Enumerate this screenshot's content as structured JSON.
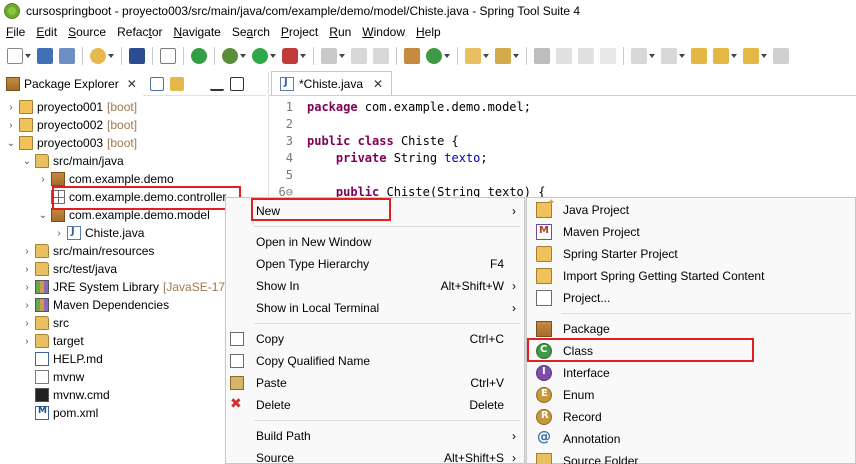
{
  "window": {
    "title": "cursospringboot - proyecto003/src/main/java/com/example/demo/model/Chiste.java - Spring Tool Suite 4"
  },
  "menu": [
    {
      "pre": "",
      "u": "F",
      "post": "ile"
    },
    {
      "pre": "",
      "u": "E",
      "post": "dit"
    },
    {
      "pre": "",
      "u": "S",
      "post": "ource"
    },
    {
      "pre": "Refac",
      "u": "t",
      "post": "or"
    },
    {
      "pre": "",
      "u": "N",
      "post": "avigate"
    },
    {
      "pre": "Se",
      "u": "a",
      "post": "rch"
    },
    {
      "pre": "",
      "u": "P",
      "post": "roject"
    },
    {
      "pre": "",
      "u": "R",
      "post": "un"
    },
    {
      "pre": "",
      "u": "W",
      "post": "indow"
    },
    {
      "pre": "",
      "u": "H",
      "post": "elp"
    }
  ],
  "explorer": {
    "tab_label": "Package Explorer",
    "close": "✕",
    "tree": [
      {
        "twisty": "›",
        "icon": "project",
        "label": "proyecto001",
        "suffix": "[boot]"
      },
      {
        "twisty": "›",
        "icon": "project",
        "label": "proyecto002",
        "suffix": "[boot]"
      },
      {
        "twisty": "⌄",
        "icon": "project",
        "label": "proyecto003",
        "suffix": "[boot]"
      },
      {
        "twisty": "⌄",
        "icon": "folder",
        "label": "src/main/java",
        "suffix": ""
      },
      {
        "twisty": "›",
        "icon": "pkg",
        "label": "com.example.demo",
        "suffix": ""
      },
      {
        "twisty": "",
        "icon": "pkg-empty",
        "label": "com.example.demo.controller",
        "suffix": ""
      },
      {
        "twisty": "⌄",
        "icon": "pkg",
        "label": "com.example.demo.model",
        "suffix": ""
      },
      {
        "twisty": "›",
        "icon": "java",
        "label": "Chiste.java",
        "suffix": ""
      },
      {
        "twisty": "›",
        "icon": "folder",
        "label": "src/main/resources",
        "suffix": ""
      },
      {
        "twisty": "›",
        "icon": "folder",
        "label": "src/test/java",
        "suffix": ""
      },
      {
        "twisty": "›",
        "icon": "lib",
        "label": "JRE System Library",
        "suffix": "[JavaSE-17]"
      },
      {
        "twisty": "›",
        "icon": "lib",
        "label": "Maven Dependencies",
        "suffix": ""
      },
      {
        "twisty": "›",
        "icon": "folder",
        "label": "src",
        "suffix": ""
      },
      {
        "twisty": "›",
        "icon": "folder",
        "label": "target",
        "suffix": ""
      },
      {
        "twisty": "",
        "icon": "md",
        "label": "HELP.md",
        "suffix": ""
      },
      {
        "twisty": "",
        "icon": "file",
        "label": "mvnw",
        "suffix": ""
      },
      {
        "twisty": "",
        "icon": "cmd",
        "label": "mvnw.cmd",
        "suffix": ""
      },
      {
        "twisty": "",
        "icon": "xml",
        "label": "pom.xml",
        "suffix": ""
      }
    ]
  },
  "editor": {
    "tab_label": "*Chiste.java",
    "close": "✕",
    "lines": [
      {
        "num": "1",
        "parts": [
          {
            "t": "package",
            "c": "kw"
          },
          {
            "t": " com.example.demo.model;",
            "c": ""
          }
        ]
      },
      {
        "num": "2",
        "parts": []
      },
      {
        "num": "3",
        "parts": [
          {
            "t": "public",
            "c": "kw"
          },
          {
            "t": " ",
            "c": ""
          },
          {
            "t": "class",
            "c": "kw"
          },
          {
            "t": " Chiste {",
            "c": ""
          }
        ]
      },
      {
        "num": "4",
        "parts": [
          {
            "t": "    ",
            "c": ""
          },
          {
            "t": "private",
            "c": "kw"
          },
          {
            "t": " String ",
            "c": ""
          },
          {
            "t": "texto",
            "c": "fld"
          },
          {
            "t": ";",
            "c": ""
          }
        ]
      },
      {
        "num": "5",
        "parts": []
      },
      {
        "num": "6⊖",
        "parts": [
          {
            "t": "    ",
            "c": ""
          },
          {
            "t": "public",
            "c": "kw"
          },
          {
            "t": " Chiste(String texto) {",
            "c": ""
          }
        ]
      }
    ]
  },
  "context_menu": {
    "items": [
      {
        "label": "New",
        "shortcut": "",
        "arrow": "›",
        "icon": "",
        "highlight": true
      },
      {
        "sep": true
      },
      {
        "label": "Open in New Window",
        "shortcut": "",
        "arrow": "",
        "icon": ""
      },
      {
        "label": "Open Type Hierarchy",
        "shortcut": "F4",
        "arrow": "",
        "icon": ""
      },
      {
        "label": "Show In",
        "shortcut": "Alt+Shift+W",
        "arrow": "›",
        "icon": ""
      },
      {
        "label": "Show in Local Terminal",
        "shortcut": "",
        "arrow": "›",
        "icon": ""
      },
      {
        "sep": true
      },
      {
        "label": "Copy",
        "shortcut": "Ctrl+C",
        "arrow": "",
        "icon": "copy"
      },
      {
        "label": "Copy Qualified Name",
        "shortcut": "",
        "arrow": "",
        "icon": "copy"
      },
      {
        "label": "Paste",
        "shortcut": "Ctrl+V",
        "arrow": "",
        "icon": "paste"
      },
      {
        "label": "Delete",
        "shortcut": "Delete",
        "arrow": "",
        "icon": "delete"
      },
      {
        "sep": true
      },
      {
        "label": "Build Path",
        "shortcut": "",
        "arrow": "›",
        "icon": ""
      },
      {
        "label": "Source",
        "shortcut": "Alt+Shift+S",
        "arrow": "›",
        "icon": ""
      }
    ]
  },
  "new_submenu": {
    "items": [
      {
        "label": "Java Project",
        "icon": "jproj"
      },
      {
        "label": "Maven Project",
        "icon": "maven"
      },
      {
        "label": "Spring Starter Project",
        "icon": "spring"
      },
      {
        "label": "Import Spring Getting Started Content",
        "icon": "import"
      },
      {
        "label": "Project...",
        "icon": "proj"
      },
      {
        "sep": true
      },
      {
        "label": "Package",
        "icon": "package"
      },
      {
        "label": "Class",
        "icon": "class",
        "highlight": true
      },
      {
        "label": "Interface",
        "icon": "interface"
      },
      {
        "label": "Enum",
        "icon": "enum"
      },
      {
        "label": "Record",
        "icon": "record"
      },
      {
        "label": "Annotation",
        "icon": "annot"
      },
      {
        "label": "Source Folder",
        "icon": "srcfolder"
      }
    ]
  },
  "colors": {
    "highlight_box": "#e02020",
    "keyword": "#7f0055",
    "field": "#0000c0",
    "boot_suffix": "#a07850"
  }
}
